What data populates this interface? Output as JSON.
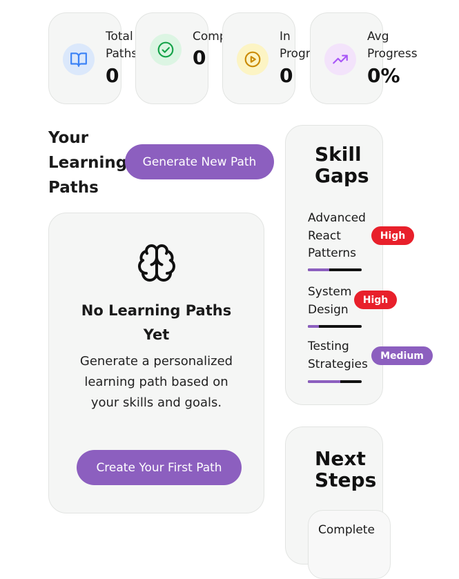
{
  "stats": [
    {
      "label": "Total Paths",
      "value": "0",
      "icon": "book-open-icon",
      "icon_bg": "#dbe8fb",
      "icon_color": "#3b82f6"
    },
    {
      "label": "Completed",
      "value": "0",
      "icon": "check-circle-icon",
      "icon_bg": "#dcf5e3",
      "icon_color": "#16a34a"
    },
    {
      "label": "In Progress",
      "value": "0",
      "icon": "play-circle-icon",
      "icon_bg": "#fcf4c4",
      "icon_color": "#ca8a04"
    },
    {
      "label": "Avg Progress",
      "value": "0%",
      "icon": "trending-up-icon",
      "icon_bg": "#f3e3fb",
      "icon_color": "#a855f7"
    }
  ],
  "paths": {
    "title": "Your Learning Paths",
    "generate_button": "Generate New Path"
  },
  "empty_state": {
    "icon": "brain-icon",
    "title": "No Learning Paths Yet",
    "description": "Generate a personalized learning path based on your skills and goals.",
    "cta": "Create Your First Path"
  },
  "skill_gaps": {
    "title": "Skill Gaps",
    "items": [
      {
        "name": "Advanced React Patterns",
        "level": "High",
        "progress": 0.4
      },
      {
        "name": "System Design",
        "level": "High",
        "progress": 0.2
      },
      {
        "name": "Testing Strategies",
        "level": "Medium",
        "progress": 0.6
      }
    ]
  },
  "next_steps": {
    "title": "Next Steps",
    "items": [
      "Complete"
    ]
  },
  "colors": {
    "accent": "#8c5fbf",
    "high_badge": "#e8202b",
    "card_bg": "#f5f6f5"
  }
}
